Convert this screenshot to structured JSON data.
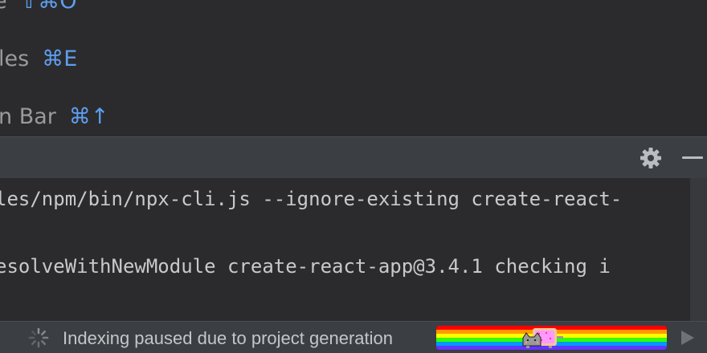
{
  "editor": {
    "hints": [
      {
        "label": "e",
        "shortcut": "⇧⌘O"
      },
      {
        "label": "les",
        "shortcut": "⌘E"
      },
      {
        "label": "n Bar",
        "shortcut": "⌘↑"
      }
    ]
  },
  "terminal": {
    "lines": [
      "les/npm/bin/npx-cli.js --ignore-existing create-react-",
      "esolveWithNewModule create-react-app@3.4.1 checking i"
    ],
    "icons": {
      "settings": "gear-icon",
      "hide": "minimize-icon"
    }
  },
  "statusbar": {
    "text": "Indexing paused due to project generation",
    "icons": {
      "spinner": "spinner-icon",
      "progress": "nyan-cat-progress",
      "run": "play-icon"
    }
  },
  "colors": {
    "background": "#2b2b2d",
    "panel_header": "#3b3e42",
    "shortcut_blue": "#5e9ef0",
    "hint_text": "#9a9a9c",
    "terminal_text": "#c9c9cb",
    "rainbow": [
      "#ff0000",
      "#ff9900",
      "#ffff00",
      "#33ff00",
      "#0099ff",
      "#6633ff"
    ]
  }
}
